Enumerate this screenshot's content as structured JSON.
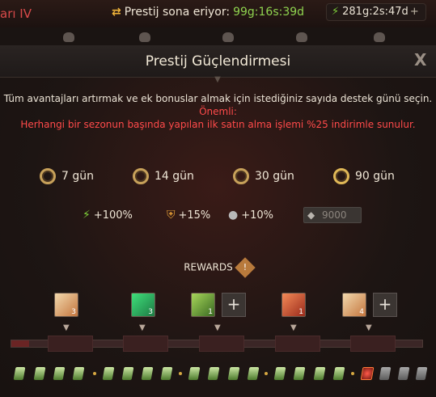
{
  "topbar": {
    "rank_label": "arı IV",
    "prestige_text": "Prestij sona eriyor:",
    "prestige_time": "99g:16s:39d",
    "energy_value": "281g:2s:47d",
    "energy_plus": "+"
  },
  "panel": {
    "title": "Prestij Güçlendirmesi",
    "close_label": "X",
    "description": "Tüm avantajları artırmak ve ek bonuslar almak için istediğiniz sayıda destek günü seçin.",
    "important_label": "Önemli:",
    "discount_text": "Herhangi bir sezonun başında yapılan ilk satın alma işlemi %25 indirimle sunulur."
  },
  "durations": [
    {
      "label": "7 gün"
    },
    {
      "label": "14 gün"
    },
    {
      "label": "30 gün"
    },
    {
      "label": "90 gün"
    }
  ],
  "bonuses": {
    "energy": "+100%",
    "shield": "+15%",
    "coin": "+10%",
    "crystal_value": "9000"
  },
  "rewards": {
    "label": "REWARDS",
    "info_icon": "!",
    "items": [
      {
        "icon": "scroll-icon",
        "qty": "3"
      },
      {
        "icon": "green-gem-icon",
        "qty": "3"
      },
      {
        "icon": "arrow-icon",
        "qty": "1"
      },
      {
        "icon": "fire-orb-icon",
        "qty": "1"
      },
      {
        "icon": "scroll-icon",
        "qty": "4"
      }
    ],
    "add_label": "+"
  },
  "colors": {
    "accent_green": "#7fd23a",
    "accent_red": "#ff4a4a",
    "gold": "#e0b857"
  }
}
